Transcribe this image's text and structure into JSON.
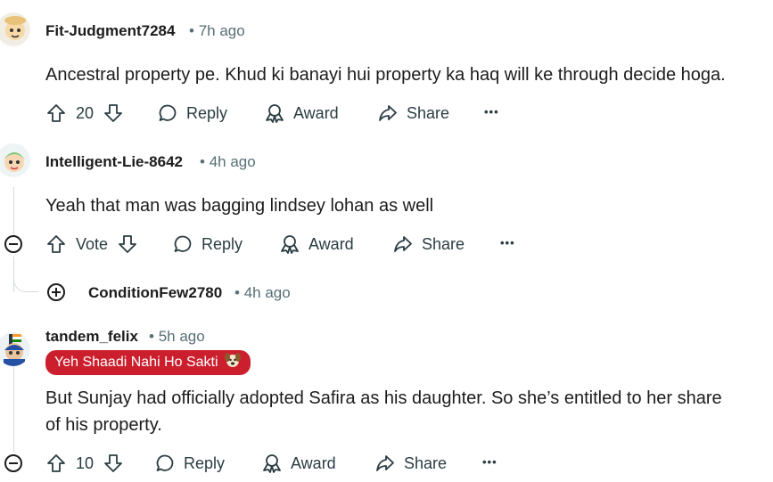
{
  "comments": [
    {
      "username": "Fit-Judgment7284",
      "time": "7h ago",
      "body": "Ancestral property pe. Khud ki banayi hui property ka haq will ke through decide hoga.",
      "votes": "20",
      "reply_label": "Reply",
      "award_label": "Award",
      "share_label": "Share",
      "more_label": "•••"
    },
    {
      "username": "Intelligent-Lie-8642",
      "time": "4h ago",
      "body": "Yeah that man was bagging lindsey lohan as well",
      "votes": "Vote",
      "reply_label": "Reply",
      "award_label": "Award",
      "share_label": "Share",
      "more_label": "•••"
    },
    {
      "username": "tandem_felix",
      "time": "5h ago",
      "flair": "Yeh Shaadi Nahi Ho Sakti",
      "body_line1": "But Sunjay had officially adopted Safira as his daughter. So she’s entitled to her share",
      "body_line2": "of his property.",
      "votes": "10",
      "reply_label": "Reply",
      "award_label": "Award",
      "share_label": "Share",
      "more_label": "•••"
    }
  ],
  "collapsed_reply": {
    "username": "ConditionFew2780",
    "time": "4h ago"
  },
  "separator": "•",
  "colors": {
    "accent_flair": "#cc1f2e",
    "meta_text": "#576f76",
    "thread_line": "#d4dadc"
  }
}
